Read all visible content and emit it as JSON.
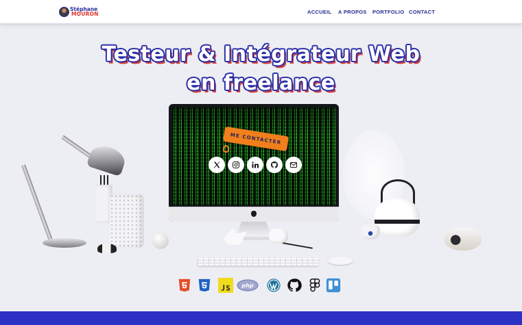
{
  "header": {
    "logo": {
      "line1": "Stéphane",
      "line2": "MOURON"
    },
    "nav": [
      {
        "label": "ACCUEIL"
      },
      {
        "label": "A PROPOS"
      },
      {
        "label": "PORTFOLIO"
      },
      {
        "label": "CONTACT"
      }
    ]
  },
  "hero": {
    "title_line1": "Testeur & Intégrateur Web",
    "title_line2": "en freelance",
    "cta_label": "ME CONTACTER"
  },
  "social_icons": [
    "x-icon",
    "instagram-icon",
    "linkedin-icon",
    "github-icon",
    "email-icon"
  ],
  "tech_icons": [
    "html5-icon",
    "css3-icon",
    "js-icon",
    "php-icon",
    "wordpress-icon",
    "github-icon",
    "figma-icon",
    "trello-icon"
  ],
  "colors": {
    "brand_blue": "#2b2fa6",
    "accent_orange": "#f07f1c",
    "background": "#edeef4",
    "footer": "#2d30c4"
  }
}
